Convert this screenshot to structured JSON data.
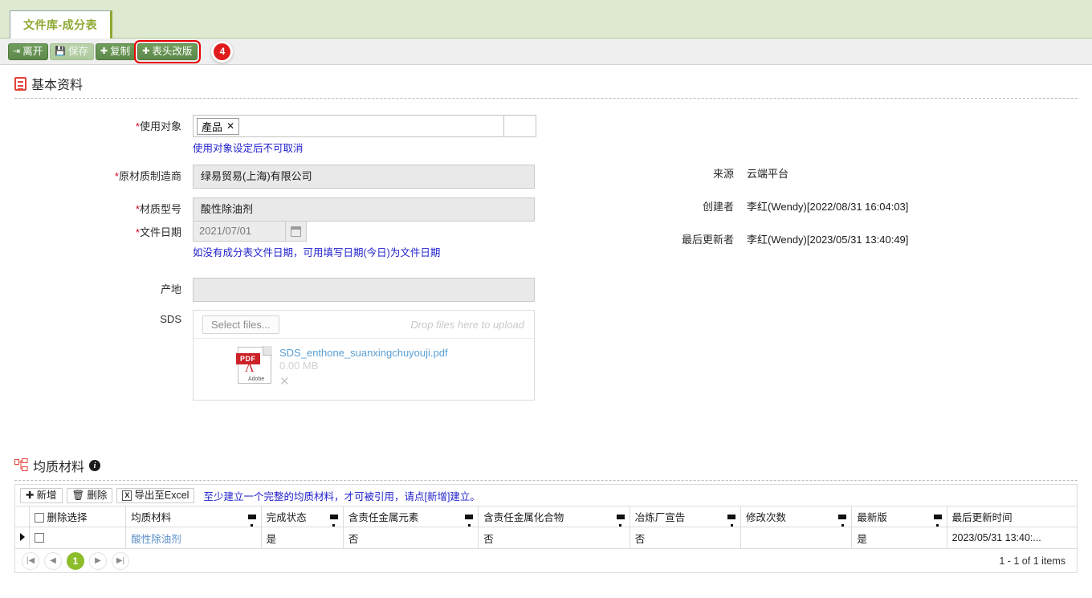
{
  "tab": {
    "label": "文件库-成分表"
  },
  "toolbar": {
    "exit": "离开",
    "save": "保存",
    "copy": "复制",
    "header_revision": "表头改版",
    "badge": "4"
  },
  "basic_section": {
    "title": "基本资料"
  },
  "form": {
    "usage_target": {
      "label": "使用对象",
      "required": "*",
      "tag": "產品",
      "tag_remove": "✕",
      "hint": "使用对象设定后不可取消"
    },
    "manufacturer": {
      "label": "原材质制造商",
      "required": "*",
      "value": "绿易贸易(上海)有限公司"
    },
    "material_model": {
      "label": "材质型号",
      "required": "*",
      "value": "酸性除油剂"
    },
    "file_date": {
      "label": "文件日期",
      "required": "*",
      "value": "2021/07/01",
      "hint": "如没有成分表文件日期，可用填写日期(今日)为文件日期"
    },
    "origin": {
      "label": "产地",
      "value": ""
    },
    "sds": {
      "label": "SDS",
      "select_files": "Select files...",
      "drop_hint": "Drop files here to upload",
      "file_name": "SDS_enthone_suanxingchuyouji.pdf",
      "file_size": "0.00 MB",
      "file_type_tag": "PDF",
      "file_brand": "Adobe",
      "remove": "✕"
    }
  },
  "meta": {
    "source": {
      "label": "来源",
      "value": "云端平台"
    },
    "creator": {
      "label": "创建者",
      "value": "李红(Wendy)[2022/08/31 16:04:03]"
    },
    "last_updater": {
      "label": "最后更新者",
      "value": "李红(Wendy)[2023/05/31 13:40:49]"
    }
  },
  "material_section": {
    "title": "均质材料"
  },
  "grid_toolbar": {
    "add": "新增",
    "delete": "删除",
    "export": "导出至Excel",
    "hint": "至少建立一个完整的均质材料，才可被引用，请点[新增]建立。"
  },
  "grid": {
    "columns": [
      "删除选择",
      "均质材料",
      "完成状态",
      "含责任金属元素",
      "含责任金属化合物",
      "冶炼厂宣告",
      "修改次数",
      "最新版",
      "最后更新时间"
    ],
    "rows": [
      {
        "material": "酸性除油剂",
        "status": "是",
        "metal_element": "否",
        "metal_compound": "否",
        "smelter_declaration": "否",
        "revisions": "",
        "latest": "是",
        "last_updated": "2023/05/31 13:40:..."
      }
    ]
  },
  "pager": {
    "first": "|◀",
    "prev": "◀",
    "current": "1",
    "next": "▶",
    "last": "▶|",
    "info": "1 - 1 of 1 items"
  }
}
